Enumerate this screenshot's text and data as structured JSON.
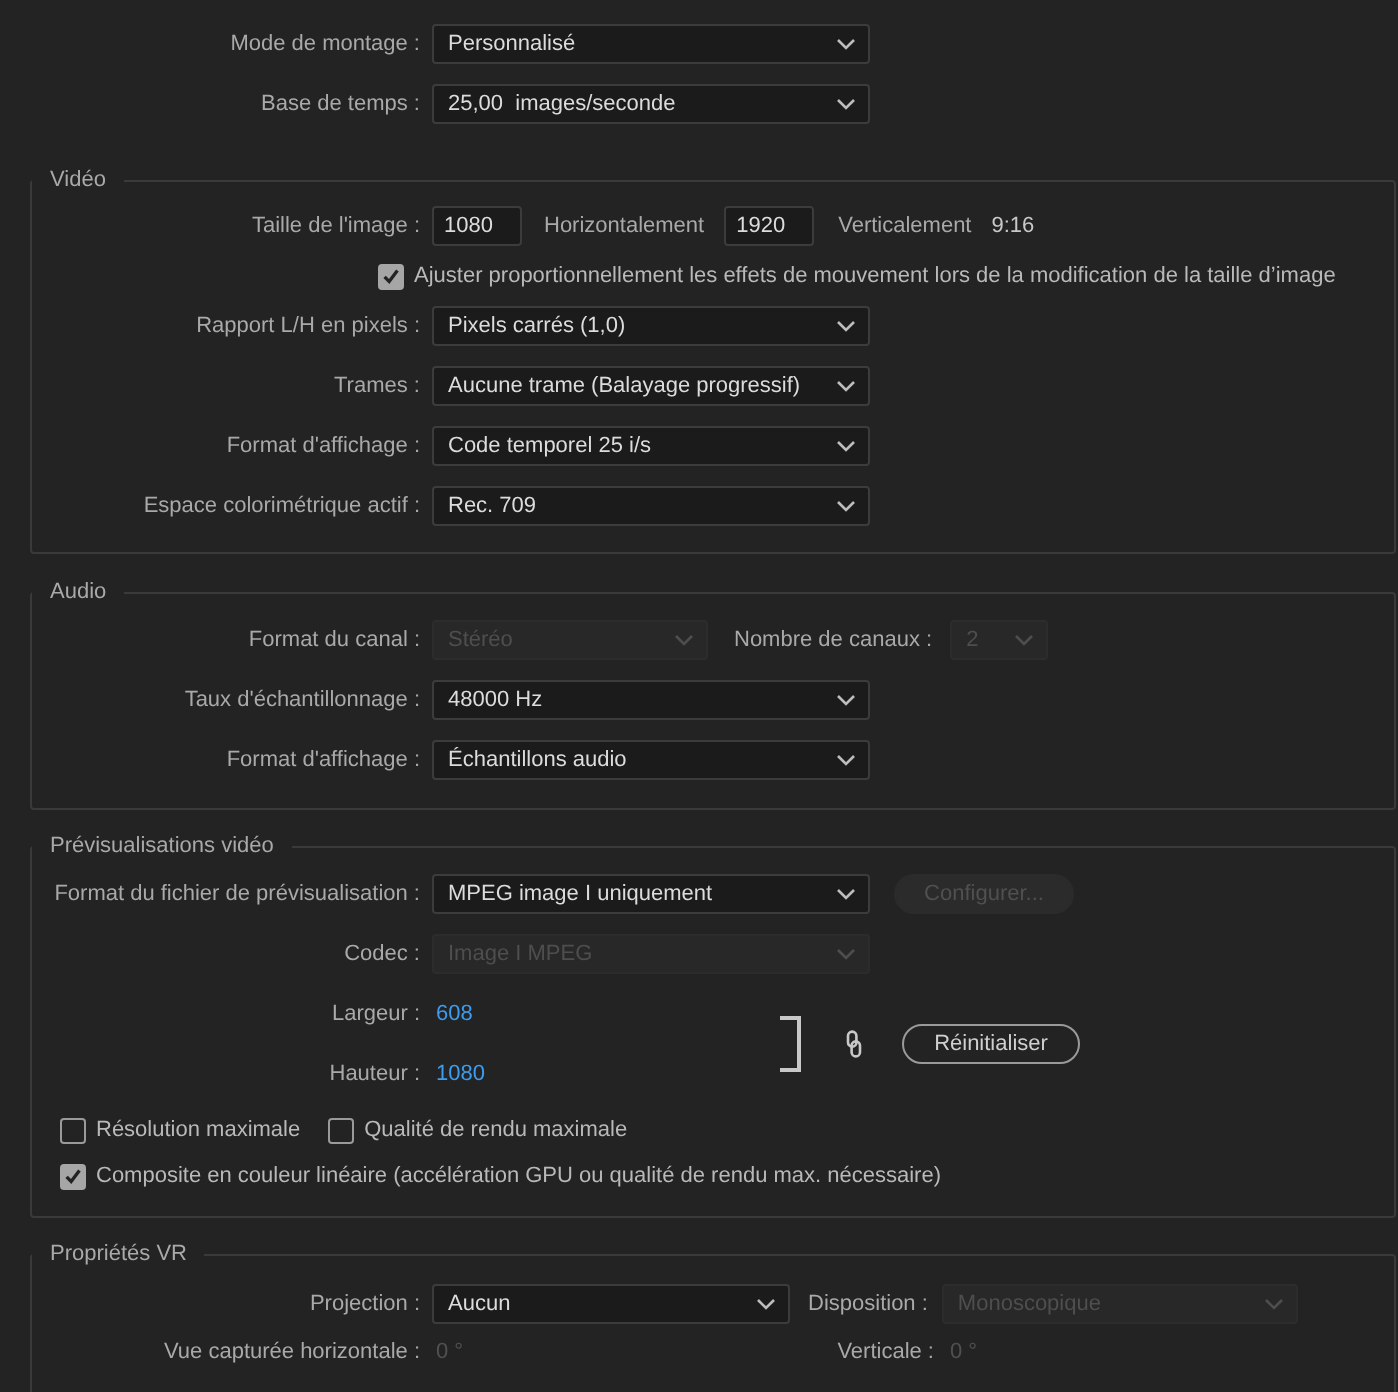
{
  "top": [
    {
      "label": "Mode de montage :",
      "value": "Personnalisé"
    },
    {
      "label": "Base de temps :",
      "value": "25,00  images/seconde"
    }
  ],
  "video": {
    "title": "Vidéo",
    "frame_size": {
      "label": "Taille de l'image :",
      "horizontal": "1080",
      "horizontal_label": "Horizontalement",
      "vertical": "1920",
      "vertical_label": "Verticalement",
      "ratio": "9:16"
    },
    "scale_option": {
      "label": "Ajuster proportionnellement les effets de mouvement lors de la modification de la taille d’image",
      "checked": true
    },
    "rows": [
      {
        "label": "Rapport L/H en pixels :",
        "value": "Pixels carrés (1,0)"
      },
      {
        "label": "Trames :",
        "value": "Aucune trame (Balayage progressif)"
      },
      {
        "label": "Format d'affichage :",
        "value": "Code temporel 25 i/s"
      },
      {
        "label": "Espace colorimétrique actif :",
        "value": "Rec. 709"
      }
    ]
  },
  "audio": {
    "title": "Audio",
    "channel_format": {
      "label": "Format du canal :",
      "value": "Stéréo",
      "disabled": true
    },
    "channel_count": {
      "label": "Nombre de canaux :",
      "value": "2",
      "disabled": true
    },
    "rows": [
      {
        "label": "Taux d'échantillonnage :",
        "value": "48000 Hz"
      },
      {
        "label": "Format d'affichage :",
        "value": "Échantillons audio"
      }
    ]
  },
  "preview": {
    "title": "Prévisualisations vidéo",
    "file_format": {
      "label": "Format du fichier de prévisualisation :",
      "value": "MPEG image I uniquement"
    },
    "configure_button": {
      "label": "Configurer...",
      "disabled": true
    },
    "codec": {
      "label": "Codec :",
      "value": "Image I MPEG",
      "disabled": true
    },
    "width": {
      "label": "Largeur :",
      "value": "608"
    },
    "height": {
      "label": "Hauteur :",
      "value": "1080"
    },
    "reset_button": "Réinitialiser",
    "options": [
      {
        "label": "Résolution maximale",
        "checked": false
      },
      {
        "label": "Qualité de rendu maximale",
        "checked": false
      },
      {
        "label": "Composite en couleur linéaire (accélération GPU ou qualité de rendu max. nécessaire)",
        "checked": true
      }
    ]
  },
  "vr": {
    "title": "Propriétés VR",
    "projection": {
      "label": "Projection :",
      "value": "Aucun"
    },
    "layout": {
      "label": "Disposition :",
      "value": "Monoscopique",
      "disabled": true
    },
    "horizontal_view": {
      "label": "Vue capturée horizontale :",
      "value": "0 °"
    },
    "vertical_view": {
      "label": "Verticale :",
      "value": "0 °"
    }
  }
}
